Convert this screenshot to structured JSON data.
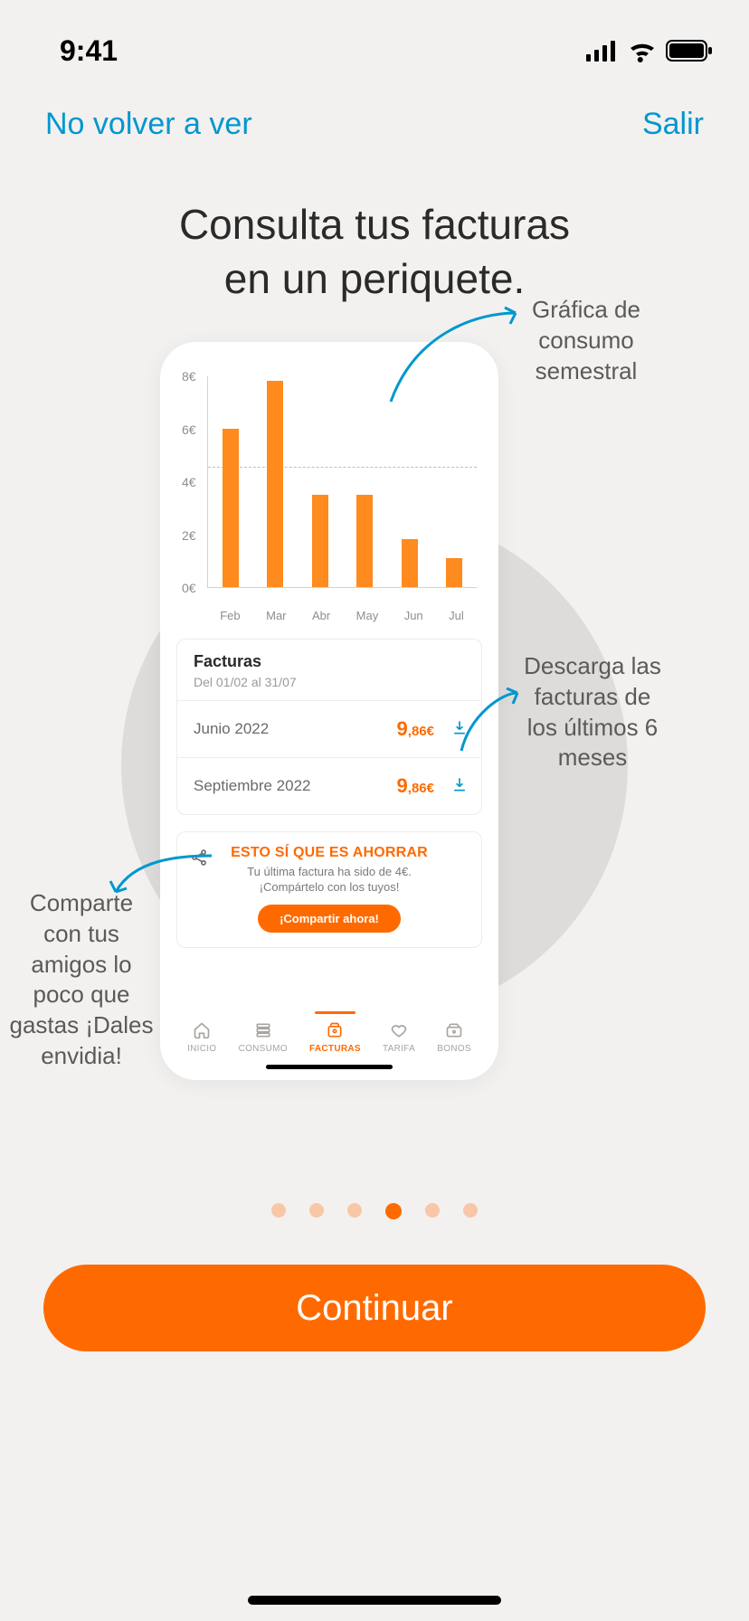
{
  "status": {
    "time": "9:41"
  },
  "header": {
    "dont_show": "No volver a ver",
    "exit": "Salir"
  },
  "title_line1": "Consulta tus facturas",
  "title_line2": "en un periquete.",
  "annotations": {
    "chart": "Gráfica de consumo semestral",
    "download": "Descarga las facturas de los últimos 6 meses",
    "share": "Comparte con tus amigos lo poco que gastas ¡Dales envidia!"
  },
  "chart_data": {
    "type": "bar",
    "categories": [
      "Feb",
      "Mar",
      "Abr",
      "May",
      "Jun",
      "Jul"
    ],
    "values": [
      6.0,
      7.8,
      3.5,
      3.5,
      1.8,
      1.1
    ],
    "title": "",
    "xlabel": "",
    "ylabel": "",
    "ylim": [
      0,
      8
    ],
    "y_ticks": [
      "0€",
      "2€",
      "4€",
      "6€",
      "8€"
    ],
    "reference_line": 4.5
  },
  "list": {
    "title": "Facturas",
    "subtitle": "Del 01/02 al 31/07",
    "rows": [
      {
        "label": "Junio 2022",
        "amount_big": "9",
        "amount_rest": ",86€"
      },
      {
        "label": "Septiembre 2022",
        "amount_big": "9",
        "amount_rest": ",86€"
      }
    ]
  },
  "share_card": {
    "title": "ESTO SÍ QUE ES AHORRAR",
    "line1": "Tu última factura ha sido de 4€.",
    "line2": "¡Compártelo con los tuyos!",
    "button": "¡Compartir ahora!"
  },
  "tabs": {
    "inicio": "INICIO",
    "consumo": "CONSUMO",
    "facturas": "FACTURAS",
    "tarifa": "TARIFA",
    "bonos": "BONOS"
  },
  "cta": "Continuar",
  "pagination": {
    "count": 6,
    "active_index": 3
  }
}
